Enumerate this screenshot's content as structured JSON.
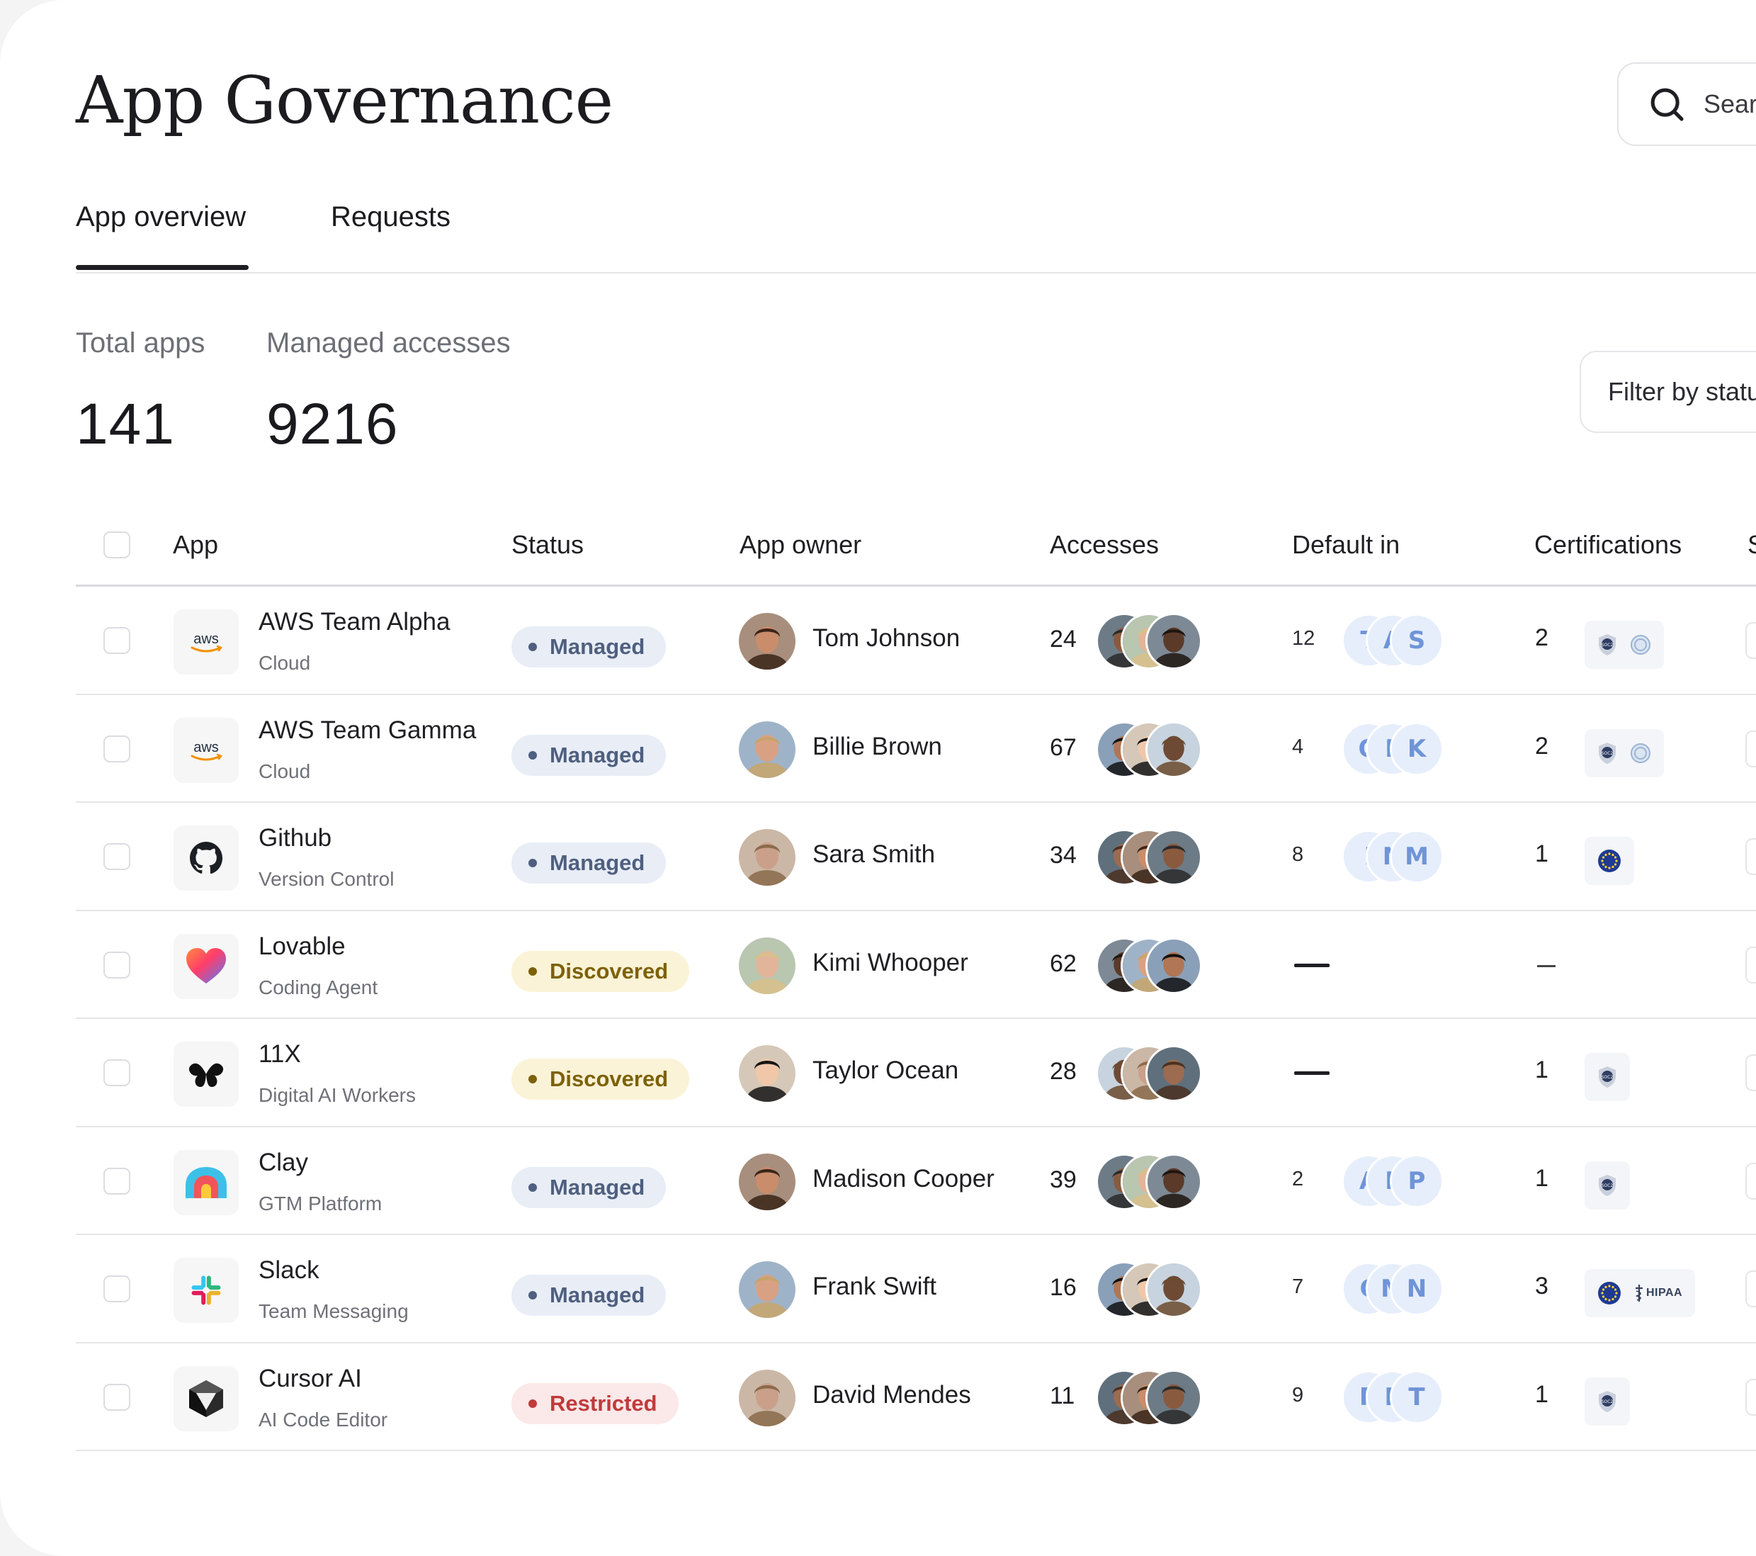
{
  "header": {
    "title": "App Governance"
  },
  "search": {
    "placeholder": "Search"
  },
  "tabs": [
    {
      "label": "App overview",
      "active": true
    },
    {
      "label": "Requests",
      "active": false
    }
  ],
  "stats": [
    {
      "label": "Total apps",
      "value": "141"
    },
    {
      "label": "Managed accesses",
      "value": "9216"
    }
  ],
  "filter": {
    "label": "Filter by status"
  },
  "table": {
    "columns": [
      "App",
      "Status",
      "App owner",
      "Accesses",
      "Default in",
      "Certifications",
      "S"
    ],
    "rows": [
      {
        "app": "AWS Team Alpha",
        "category": "Cloud",
        "logo": "aws-logo-icon",
        "status": "Managed",
        "status_type": "managed",
        "owner": "Tom Johnson",
        "accesses": "24",
        "default_count": "12",
        "default_initials": [
          "T",
          "A",
          "S"
        ],
        "cert_count": "2",
        "certs": [
          "soc2-icon",
          "iso-icon"
        ]
      },
      {
        "app": "AWS Team Gamma",
        "category": "Cloud",
        "logo": "aws-logo-icon",
        "status": "Managed",
        "status_type": "managed",
        "owner": "Billie Brown",
        "accesses": "67",
        "default_count": "4",
        "default_initials": [
          "O",
          "L",
          "K"
        ],
        "cert_count": "2",
        "certs": [
          "soc2-icon",
          "iso-icon"
        ]
      },
      {
        "app": "Github",
        "category": "Version Control",
        "logo": "github-logo-icon",
        "status": "Managed",
        "status_type": "managed",
        "owner": "Sara Smith",
        "accesses": "34",
        "default_count": "8",
        "default_initials": [
          "I",
          "N",
          "M"
        ],
        "cert_count": "1",
        "certs": [
          "gdpr-icon"
        ]
      },
      {
        "app": "Lovable",
        "category": "Coding Agent",
        "logo": "lovable-logo-icon",
        "status": "Discovered",
        "status_type": "discovered",
        "owner": "Kimi Whooper",
        "accesses": "62",
        "default_count": "",
        "default_initials": [],
        "cert_count": "",
        "certs": []
      },
      {
        "app": "11X",
        "category": "Digital AI Workers",
        "logo": "11x-logo-icon",
        "status": "Discovered",
        "status_type": "discovered",
        "owner": "Taylor Ocean",
        "accesses": "28",
        "default_count": "",
        "default_initials": [],
        "cert_count": "1",
        "certs": [
          "soc2-icon"
        ]
      },
      {
        "app": "Clay",
        "category": "GTM Platform",
        "logo": "clay-logo-icon",
        "status": "Managed",
        "status_type": "managed",
        "owner": "Madison Cooper",
        "accesses": "39",
        "default_count": "2",
        "default_initials": [
          "A",
          "L",
          "P"
        ],
        "cert_count": "1",
        "certs": [
          "soc2-icon"
        ]
      },
      {
        "app": "Slack",
        "category": "Team Messaging",
        "logo": "slack-logo-icon",
        "status": "Managed",
        "status_type": "managed",
        "owner": "Frank Swift",
        "accesses": "16",
        "default_count": "7",
        "default_initials": [
          "C",
          "M",
          "N"
        ],
        "cert_count": "3",
        "certs": [
          "gdpr-icon",
          "hipaa-icon"
        ],
        "cert_text": "HIPAA"
      },
      {
        "app": "Cursor AI",
        "category": "AI Code Editor",
        "logo": "cursor-logo-icon",
        "status": "Restricted",
        "status_type": "restricted",
        "owner": "David Mendes",
        "accesses": "11",
        "default_count": "9",
        "default_initials": [
          "R",
          "E",
          "T"
        ],
        "cert_count": "1",
        "certs": [
          "soc2-icon"
        ]
      }
    ]
  },
  "colors": {
    "managed_bg": "#e8edf6",
    "managed_text": "#4f5f7f",
    "discovered_bg": "#fbf3d7",
    "discovered_text": "#7d6108",
    "restricted_bg": "#fbe8e8",
    "restricted_text": "#c03b3b",
    "initials_chip_bg": "#e6eefb",
    "initials_chip_text": "#6f94d8"
  }
}
